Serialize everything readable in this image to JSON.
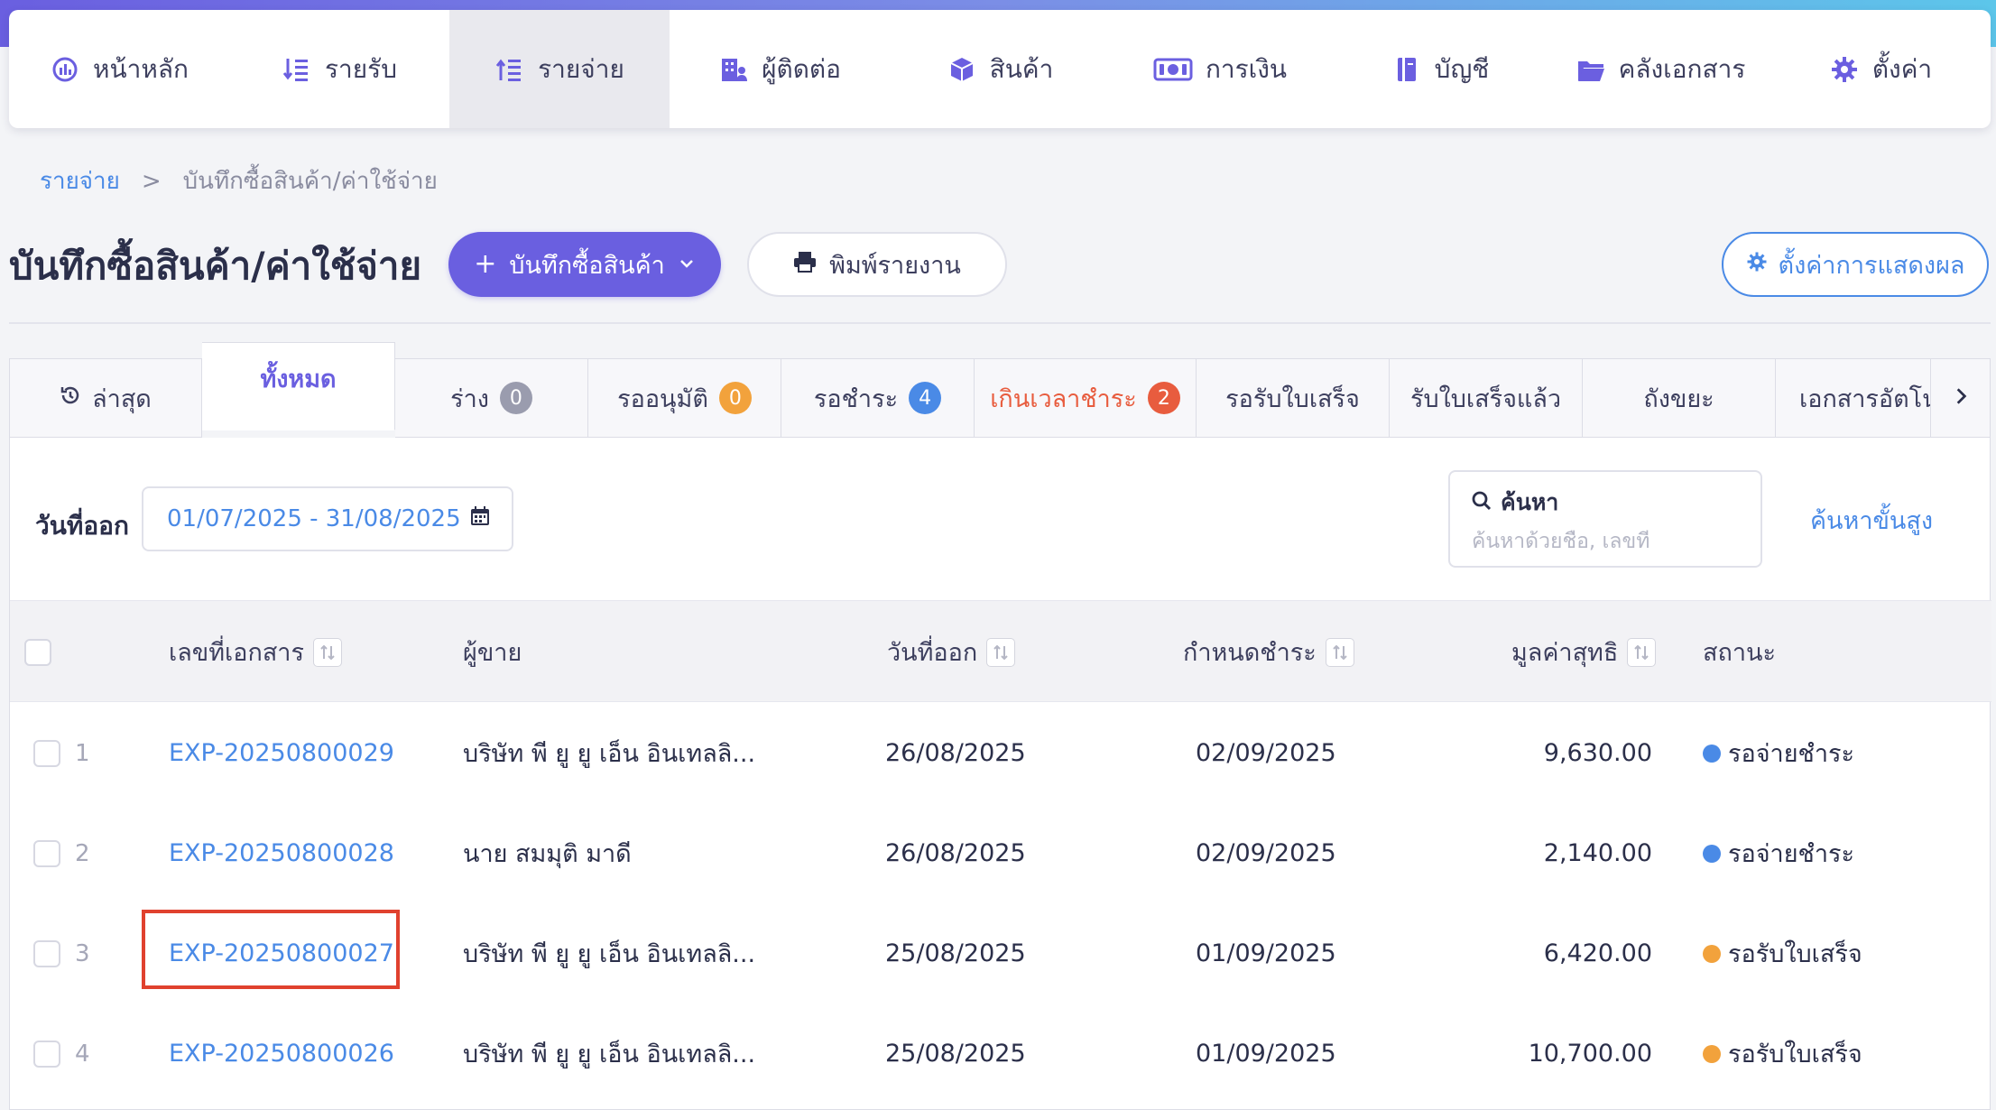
{
  "nav": {
    "items": [
      {
        "label": "หน้าหลัก",
        "icon": "dashboard-icon"
      },
      {
        "label": "รายรับ",
        "icon": "income-list-icon"
      },
      {
        "label": "รายจ่าย",
        "icon": "expense-list-icon",
        "active": true
      },
      {
        "label": "ผู้ติดต่อ",
        "icon": "contacts-building-icon"
      },
      {
        "label": "สินค้า",
        "icon": "box-icon"
      },
      {
        "label": "การเงิน",
        "icon": "money-icon"
      },
      {
        "label": "บัญชี",
        "icon": "ledger-book-icon"
      },
      {
        "label": "คลังเอกสาร",
        "icon": "folder-icon"
      },
      {
        "label": "ตั้งค่า",
        "icon": "gear-icon"
      }
    ]
  },
  "breadcrumb": {
    "parent": "รายจ่าย",
    "separator": ">",
    "current": "บันทึกซื้อสินค้า/ค่าใช้จ่าย"
  },
  "page": {
    "title": "บันทึกซื้อสินค้า/ค่าใช้จ่าย",
    "primary_button": "บันทึกซื้อสินค้า",
    "print_button": "พิมพ์รายงาน",
    "display_settings_button": "ตั้งค่าการแสดงผล"
  },
  "tabs": [
    {
      "label": "ล่าสุด",
      "icon": "history-icon"
    },
    {
      "label": "ทั้งหมด",
      "active": true
    },
    {
      "label": "ร่าง",
      "badge": "0",
      "badge_color": "#9a9cae"
    },
    {
      "label": "รออนุมัติ",
      "badge": "0",
      "badge_color": "#f2a23c"
    },
    {
      "label": "รอชำระ",
      "badge": "4",
      "badge_color": "#4a8ae6"
    },
    {
      "label": "เกินเวลาชำระ",
      "badge": "2",
      "badge_color": "#e85c3e",
      "overdue": true
    },
    {
      "label": "รอรับใบเสร็จ"
    },
    {
      "label": "รับใบเสร็จแล้ว"
    },
    {
      "label": "ถังขยะ"
    },
    {
      "label": "เอกสารอัตโน"
    }
  ],
  "filters": {
    "date_label": "วันที่ออก",
    "date_range": "01/07/2025 - 31/08/2025",
    "search_label": "ค้นหา",
    "search_placeholder": "ค้นหาด้วยชื่อ, เลขที่",
    "advanced_search": "ค้นหาขั้นสูง"
  },
  "table": {
    "columns": {
      "doc_no": "เลขที่เอกสาร",
      "vendor": "ผู้ขาย",
      "issue_date": "วันที่ออก",
      "due_date": "กำหนดชำระ",
      "net_value": "มูลค่าสุทธิ",
      "status": "สถานะ"
    },
    "rows": [
      {
        "num": "1",
        "doc_no": "EXP-20250800029",
        "vendor": "บริษัท พี ยู ยู เอ็น อินเทลลิ...",
        "issue_date": "26/08/2025",
        "due_date": "02/09/2025",
        "net_value": "9,630.00",
        "status": "รอจ่ายชำระ",
        "status_color": "#4a8ae6"
      },
      {
        "num": "2",
        "doc_no": "EXP-20250800028",
        "vendor": "นาย สมมุติ มาดี",
        "issue_date": "26/08/2025",
        "due_date": "02/09/2025",
        "net_value": "2,140.00",
        "status": "รอจ่ายชำระ",
        "status_color": "#4a8ae6"
      },
      {
        "num": "3",
        "doc_no": "EXP-20250800027",
        "vendor": "บริษัท พี ยู ยู เอ็น อินเทลลิ...",
        "issue_date": "25/08/2025",
        "due_date": "01/09/2025",
        "net_value": "6,420.00",
        "status": "รอรับใบเสร็จ",
        "status_color": "#f2a23c"
      },
      {
        "num": "4",
        "doc_no": "EXP-20250800026",
        "vendor": "บริษัท พี ยู ยู เอ็น อินเทลลิ...",
        "issue_date": "25/08/2025",
        "due_date": "01/09/2025",
        "net_value": "10,700.00",
        "status": "รอรับใบเสร็จ",
        "status_color": "#f2a23c"
      }
    ]
  }
}
